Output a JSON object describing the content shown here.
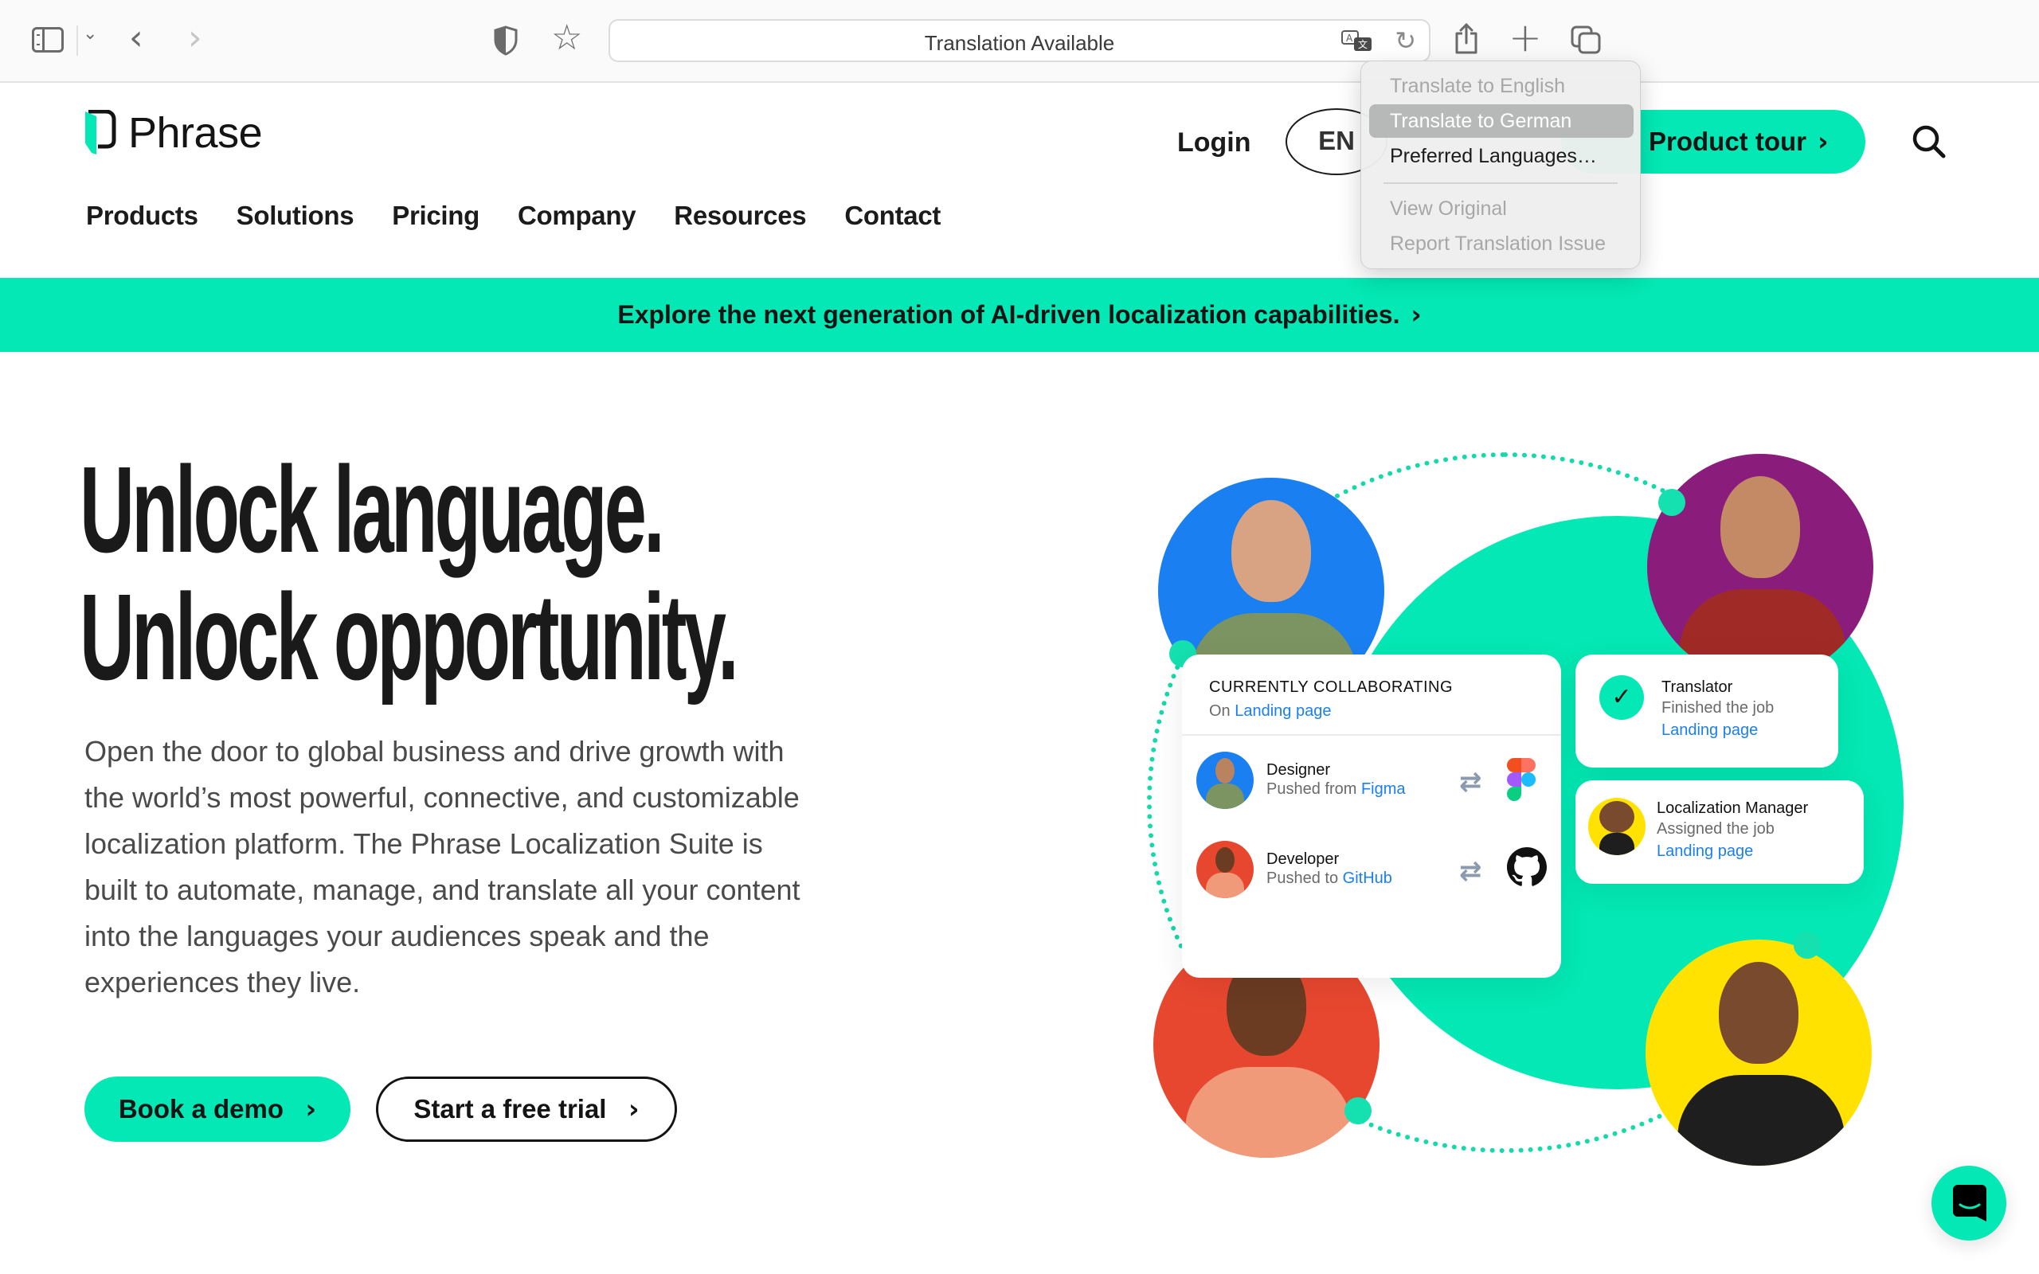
{
  "browser": {
    "url_bar_text": "Translation Available",
    "icons": {
      "sidebar": "sidebar-toggle-icon",
      "sidebar_menu": "chevron-down-icon",
      "back": "chevron-left-icon",
      "forward": "chevron-right-icon",
      "privacy": "shield-icon",
      "bookmark": "star-icon",
      "translate": "translate-icon",
      "reload": "reload-icon",
      "share": "share-icon",
      "new_tab": "plus-icon",
      "tab_overview": "tabs-icon"
    },
    "translate_menu": {
      "items": [
        {
          "label": "Translate to English",
          "state": "disabled"
        },
        {
          "label": "Translate to German",
          "state": "highlighted"
        },
        {
          "label": "Preferred Languages…",
          "state": "enabled"
        },
        {
          "label": "View Original",
          "state": "disabled"
        },
        {
          "label": "Report Translation Issue",
          "state": "disabled"
        }
      ]
    }
  },
  "site": {
    "brand": {
      "name": "Phrase",
      "accent_color": "#03e8b4"
    },
    "nav": {
      "items": [
        "Products",
        "Solutions",
        "Pricing",
        "Company",
        "Resources",
        "Contact"
      ]
    },
    "header": {
      "login": "Login",
      "language": "EN",
      "product_tour": "Product tour",
      "chevron": "›"
    },
    "banner": {
      "text": "Explore the next generation of AI-driven localization capabilities.",
      "chevron": "›"
    },
    "hero": {
      "headline_line1": "Unlock language.",
      "headline_line2": "Unlock opportunity.",
      "description": "Open the door to global business and drive growth with the world’s most powerful, connective, and customizable localization platform. The Phrase Localization Suite is built to automate, manage, and translate all your content into the languages your audiences speak and the experiences they live.",
      "primary_cta": "Book a demo",
      "secondary_cta": "Start a free trial",
      "chevron": "›"
    },
    "illustration": {
      "collab_card": {
        "title": "CURRENTLY COLLABORATING",
        "subtitle_prefix": "On",
        "subtitle_link": "Landing page",
        "rows": [
          {
            "role": "Designer",
            "action_prefix": "Pushed from",
            "action_link": "Figma",
            "tool": "figma-logo-icon"
          },
          {
            "role": "Developer",
            "action_prefix": "Pushed to",
            "action_link": "GitHub",
            "tool": "github-logo-icon"
          }
        ],
        "swap_glyph": "⇄"
      },
      "translator_card": {
        "role": "Translator",
        "action": "Finished the job",
        "link": "Landing page",
        "check_glyph": "✓"
      },
      "manager_card": {
        "role": "Localization Manager",
        "action": "Assigned the job",
        "link": "Landing page"
      },
      "avatar_colors": {
        "designer": "#1a7ff0",
        "translator": "#8a1c7c",
        "developer": "#e8472f",
        "manager": "#ffe200"
      },
      "link_color": "#1a7ff0"
    },
    "chat_widget": {
      "icon": "chat-bubble-icon"
    }
  }
}
